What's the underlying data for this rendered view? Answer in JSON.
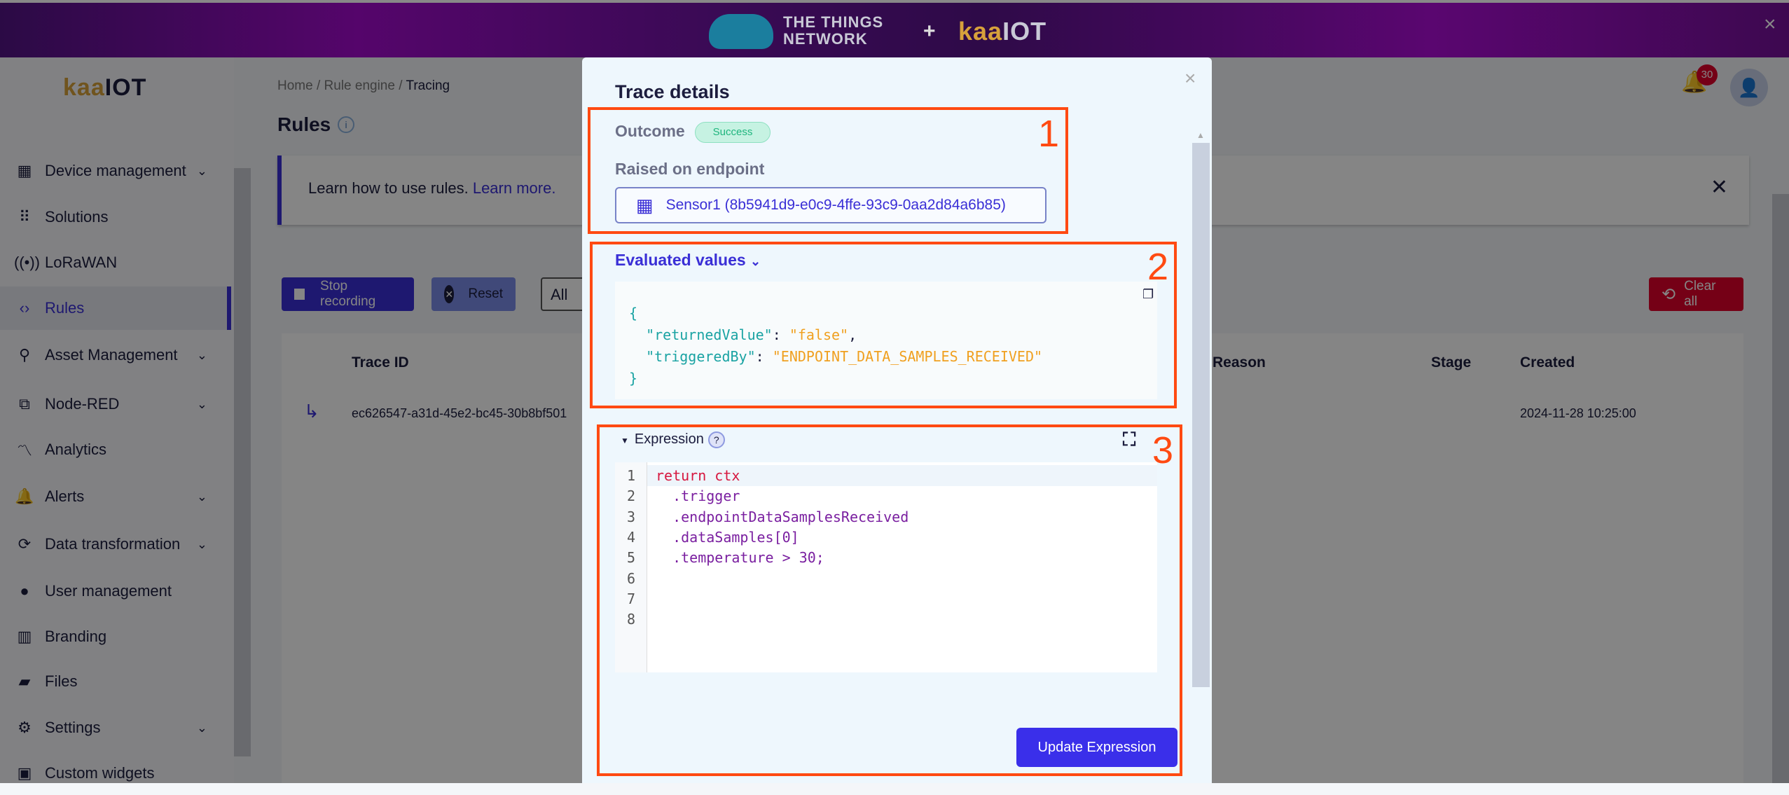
{
  "banner": {
    "ttn_line1": "THE THINGS",
    "ttn_line2": "NETWORK",
    "plus": "+",
    "kaa_k": "kaa",
    "kaa_i": "IOT",
    "close": "×"
  },
  "sidebar": {
    "logo_k": "kaa",
    "logo_i": "IOT",
    "items": [
      {
        "label": "Device management",
        "icon": "device-icon",
        "glyph": "▦",
        "chevron": true
      },
      {
        "label": "Solutions",
        "icon": "grid-icon",
        "glyph": "⠿",
        "chevron": false
      },
      {
        "label": "LoRaWAN",
        "icon": "antenna-icon",
        "glyph": "((•))",
        "chevron": false
      },
      {
        "label": "Rules",
        "icon": "code-icon",
        "glyph": "‹›",
        "chevron": false,
        "active": true
      },
      {
        "label": "Asset Management",
        "icon": "asset-icon",
        "glyph": "⚲",
        "chevron": true
      },
      {
        "label": "Node-RED",
        "icon": "node-red-icon",
        "glyph": "⧉",
        "chevron": true
      },
      {
        "label": "Analytics",
        "icon": "analytics-icon",
        "glyph": "〽",
        "chevron": false
      },
      {
        "label": "Alerts",
        "icon": "bell-icon",
        "glyph": "🔔",
        "chevron": true
      },
      {
        "label": "Data transformation",
        "icon": "transform-icon",
        "glyph": "⟳",
        "chevron": true
      },
      {
        "label": "User management",
        "icon": "user-icon",
        "glyph": "●",
        "chevron": false
      },
      {
        "label": "Branding",
        "icon": "building-icon",
        "glyph": "▥",
        "chevron": false
      },
      {
        "label": "Files",
        "icon": "folder-icon",
        "glyph": "▰",
        "chevron": false
      },
      {
        "label": "Settings",
        "icon": "gear-icon",
        "glyph": "⚙",
        "chevron": true
      },
      {
        "label": "Custom widgets",
        "icon": "widgets-icon",
        "glyph": "▣",
        "chevron": false
      }
    ]
  },
  "header": {
    "breadcrumb": [
      "Home",
      "Rule engine",
      "Tracing"
    ],
    "notifications": "30"
  },
  "page": {
    "title": "Rules",
    "info_text": "Learn how to use rules.",
    "info_link": "Learn more.",
    "stop_recording": "Stop recording",
    "reset": "Reset",
    "filter": "All",
    "clear_all": "Clear all",
    "columns": [
      "Trace ID",
      "Reason",
      "Stage",
      "Created"
    ],
    "row": {
      "trace_id": "ec626547-a31d-45e2-bc45-30b8bf501",
      "created": "2024-11-28 10:25:00"
    }
  },
  "modal": {
    "title": "Trace details",
    "outcome_label": "Outcome",
    "outcome": "Success",
    "raised_label": "Raised on endpoint",
    "endpoint": "Sensor1 (8b5941d9-e0c9-4ffe-93c9-0aa2d84a6b85)",
    "evaluated_label": "Evaluated values",
    "json": {
      "open": "{",
      "k1": "\"returnedValue\"",
      "v1": "\"false\"",
      "k2": "\"triggeredBy\"",
      "v2": "\"ENDPOINT_DATA_SAMPLES_RECEIVED\"",
      "close": "}"
    },
    "expression_label": "Expression",
    "help": "?",
    "code_lines": [
      "return ctx",
      "  .trigger",
      "  .endpointDataSamplesReceived",
      "  .dataSamples[0]",
      "  .temperature > 30;",
      "",
      "",
      ""
    ],
    "update_button": "Update Expression"
  },
  "annotations": [
    "1",
    "2",
    "3"
  ],
  "colors": {
    "accent": "#3a2fd6",
    "danger": "#e0002b",
    "success": "#1fb57e",
    "annotation": "#ff4a12"
  }
}
